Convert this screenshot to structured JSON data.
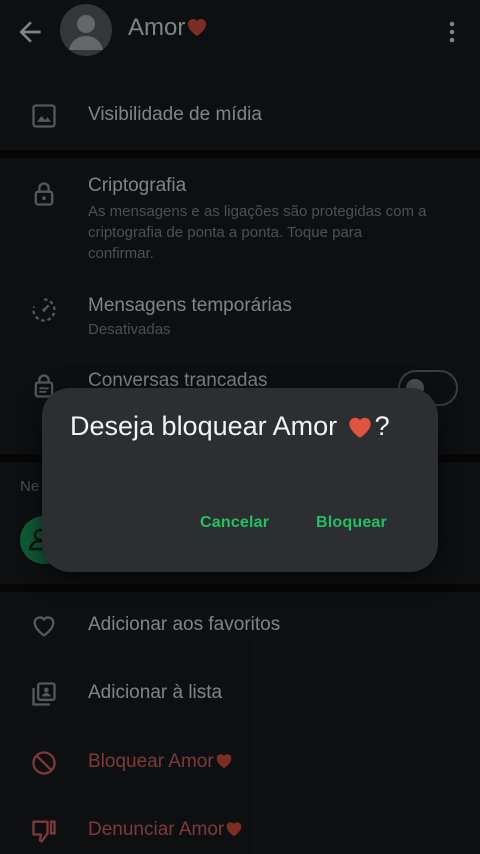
{
  "header": {
    "title": "Amor",
    "heart": "❤️",
    "icons": [
      "back-arrow-icon",
      "avatar",
      "more-vert-icon"
    ]
  },
  "rows": {
    "media": {
      "label": "Visibilidade de mídia"
    },
    "crypto": {
      "label": "Criptografia",
      "sub": "As mensagens e as ligações são protegidas com a criptografia de ponta a ponta. Toque para confirmar."
    },
    "temp": {
      "label": "Mensagens temporárias",
      "sub": "Desativadas"
    },
    "locked": {
      "label": "Conversas trancadas",
      "toggle_on": false
    },
    "partial": {
      "label": "Ne"
    },
    "fav": {
      "label": "Adicionar aos favoritos"
    },
    "list": {
      "label": "Adicionar à lista"
    },
    "block": {
      "label": "Bloquear Amor"
    },
    "report": {
      "label": "Denunciar Amor"
    }
  },
  "dialog": {
    "title": "Deseja bloquear Amor",
    "title_suffix": "?",
    "cancel": "Cancelar",
    "confirm": "Bloquear"
  },
  "colors": {
    "accent": "#21c063",
    "danger": "#e3686b",
    "dialog_bg": "#2c2e31",
    "surface": "#1b1d20"
  }
}
